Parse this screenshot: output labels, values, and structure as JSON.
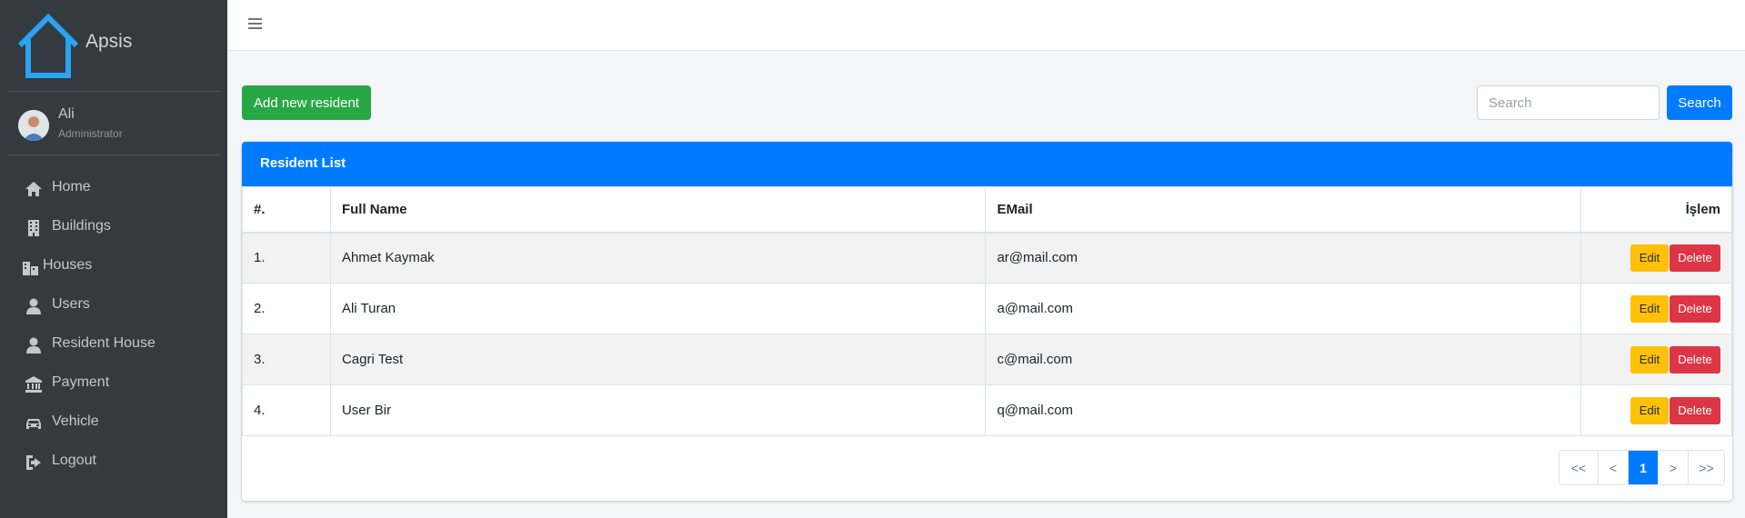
{
  "brand": {
    "name": "Apsis",
    "icon": "house-icon",
    "color": "#2aa3f0"
  },
  "user": {
    "name": "Ali",
    "role": "Administrator"
  },
  "sidebar": {
    "items": [
      {
        "label": "Home",
        "icon": "home-icon"
      },
      {
        "label": "Buildings",
        "icon": "building-icon"
      },
      {
        "label": "Houses",
        "icon": "houses-icon"
      },
      {
        "label": "Users",
        "icon": "user-icon"
      },
      {
        "label": "Resident House",
        "icon": "user-icon"
      },
      {
        "label": "Payment",
        "icon": "bank-icon"
      },
      {
        "label": "Vehicle",
        "icon": "car-icon"
      },
      {
        "label": "Logout",
        "icon": "logout-icon"
      }
    ]
  },
  "toolbar": {
    "add_label": "Add new resident",
    "search_placeholder": "Search",
    "search_label": "Search"
  },
  "card": {
    "title": "Resident List"
  },
  "table": {
    "headers": {
      "num": "#.",
      "name": "Full Name",
      "email": "EMail",
      "actions": "İşlem"
    },
    "rows": [
      {
        "num": "1.",
        "name": "Ahmet Kaymak",
        "email": "ar@mail.com"
      },
      {
        "num": "2.",
        "name": "Ali Turan",
        "email": "a@mail.com"
      },
      {
        "num": "3.",
        "name": "Cagri Test",
        "email": "c@mail.com"
      },
      {
        "num": "4.",
        "name": "User Bir",
        "email": "q@mail.com"
      }
    ],
    "edit_label": "Edit",
    "delete_label": "Delete"
  },
  "pagination": {
    "first": "<<",
    "prev": "<",
    "current": "1",
    "next": ">",
    "last": ">>"
  },
  "colors": {
    "sidebar": "#343a40",
    "primary": "#007bff",
    "success": "#28a745",
    "warning": "#ffc107",
    "danger": "#dc3545"
  }
}
